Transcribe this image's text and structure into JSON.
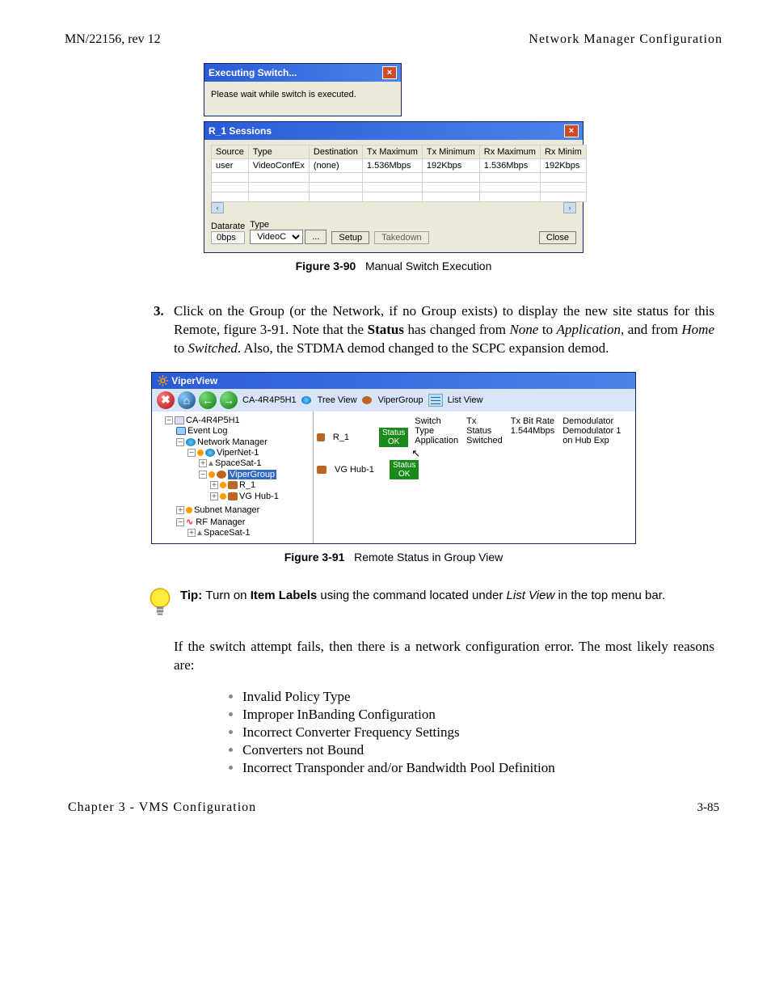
{
  "header": {
    "left": "MN/22156, rev 12",
    "right": "Network Manager Configuration"
  },
  "dlg_exec": {
    "title": "Executing Switch...",
    "msg": "Please wait while switch is executed."
  },
  "sessions": {
    "title": "R_1 Sessions",
    "cols": [
      "Source",
      "Type",
      "Destination",
      "Tx Maximum",
      "Tx Minimum",
      "Rx Maximum",
      "Rx Minim"
    ],
    "rows": [
      [
        "user",
        "VideoConfEx",
        "(none)",
        "1.536Mbps",
        "192Kbps",
        "1.536Mbps",
        "192Kbps"
      ]
    ],
    "datarate_lbl": "Datarate",
    "datarate_val": "0bps",
    "type_lbl": "Type",
    "type_val": "VideoC",
    "ellipsis": "...",
    "setup": "Setup",
    "takedown": "Takedown",
    "close": "Close"
  },
  "fig90": {
    "label": "Figure 3-90",
    "title": "Manual Switch Execution"
  },
  "step3": {
    "num": "3.",
    "text_a": "Click on the Group (or the Network, if no Group exists) to display the new site status for this Remote, figure 3-91. Note that the ",
    "status": "Status",
    "text_b": " has changed from ",
    "none": "None",
    "text_c": " to ",
    "app": "Application",
    "text_d": ", and from ",
    "home": "Home",
    "text_e": " to ",
    "switched": "Switched",
    "text_f": ". Also, the STDMA demod changed to the SCPC expansion demod."
  },
  "viper": {
    "title": "ViperView",
    "breadcrumb1": "CA-4R4P5H1",
    "treeview": "Tree View",
    "breadcrumb2": "ViperGroup",
    "listview": "List View",
    "tree": {
      "root": "CA-4R4P5H1",
      "eventlog": "Event Log",
      "netmgr": "Network Manager",
      "vipernet": "ViperNet-1",
      "spacesat": "SpaceSat-1",
      "vipergroup": "ViperGroup",
      "r1": "R_1",
      "vghub": "VG Hub-1",
      "subnet": "Subnet Manager",
      "rfmgr": "RF Manager",
      "spacesat2": "SpaceSat-1"
    },
    "list": {
      "r1": "R_1",
      "vghub": "VG Hub-1",
      "status": "Status",
      "ok": "OK",
      "cols": [
        "Switch Type",
        "Tx Status",
        "Tx Bit Rate",
        "Demodulator"
      ],
      "r1row": [
        "Application",
        "Switched",
        "1.544Mbps",
        "Demodulator 1 on Hub Exp"
      ]
    }
  },
  "fig91": {
    "label": "Figure 3-91",
    "title": "Remote Status in Group View"
  },
  "tip": {
    "label": "Tip:",
    "text_a": "Turn on ",
    "itemlabels": "Item Labels",
    "text_b": " using the command located under ",
    "listview": "List View",
    "text_c": " in the top menu bar."
  },
  "failtext": "If the switch attempt fails, then there is a network configuration error. The most likely reasons are:",
  "reasons": [
    "Invalid Policy Type",
    "Improper InBanding Configuration",
    "Incorrect Converter Frequency Settings",
    "Converters not Bound",
    "Incorrect Transponder and/or Bandwidth Pool Definition"
  ],
  "footer": {
    "left": "Chapter 3 - VMS Configuration",
    "right": "3-85"
  }
}
